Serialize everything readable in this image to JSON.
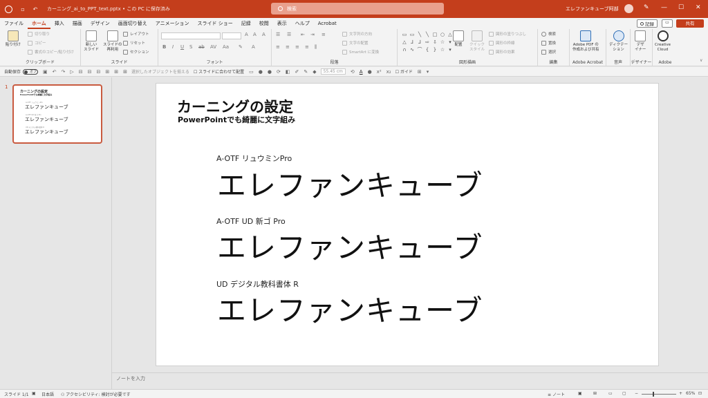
{
  "titlebar": {
    "doc_title": "カーニング_ai_to_PPT_text.pptx • この PC に保存済み",
    "search_placeholder": "検索",
    "user": "エレファンキューブ阿部",
    "accent": "#c43e1c"
  },
  "menu": {
    "tabs": [
      "ファイル",
      "ホーム",
      "挿入",
      "描画",
      "デザイン",
      "画面切り替え",
      "アニメーション",
      "スライド ショー",
      "記録",
      "校閲",
      "表示",
      "ヘルプ",
      "Acrobat"
    ],
    "active_tab": "ホーム",
    "record_label": "記録",
    "share_label": "共有"
  },
  "ribbon": {
    "clipboard": {
      "label": "クリップボード",
      "paste": "貼り付け",
      "cut": "切り取り",
      "copy": "コピー",
      "format_painter": "書式のコピー/貼り付け"
    },
    "slides": {
      "label": "スライド",
      "new_slide": "新しい\nスライド",
      "reuse": "スライドの\n再利用",
      "layout": "レイアウト",
      "reset": "リセット",
      "section": "セクション"
    },
    "font": {
      "label": "フォント"
    },
    "paragraph": {
      "label": "段落",
      "text_direction": "文字列の方向",
      "align_text": "文字の配置",
      "smartart": "SmartArt に変換"
    },
    "drawing": {
      "label": "図形描画",
      "arrange": "配置",
      "quick_styles": "クイック\nスタイル",
      "fill": "図形の塗りつぶし",
      "outline": "図形の枠線",
      "effects": "図形の効果"
    },
    "editing": {
      "label": "編集",
      "find": "検索",
      "replace": "置換",
      "select": "選択"
    },
    "acrobat": {
      "label": "Adobe Acrobat",
      "create_pdf": "Adobe PDF の\n作成および共有"
    },
    "voice": {
      "label": "音声",
      "dictate": "ディクテー\nション"
    },
    "designer": {
      "label": "デザイナー",
      "designer": "デザ\nイナー"
    },
    "adobe": {
      "label": "Adobe",
      "cc": "Creative\nCloud"
    }
  },
  "qat": {
    "autosave": "自動保存",
    "toggle": "オフ",
    "select_same": "選択したオブジェクトを揃える",
    "fit_slide": "スライドに合わせて配置",
    "size_value": "55.45 cm",
    "guide": "ガイド"
  },
  "thumbnail": {
    "number": "1",
    "title": "カーニングの設定",
    "subtitle": "PowerPointでも綺麗に文字組み",
    "sample": "エレファンキューブ"
  },
  "slide": {
    "title": "カーニングの設定",
    "subtitle": "PowerPointでも綺麗に文字組み",
    "samples": [
      {
        "font_label": "A-OTF リュウミンPro",
        "text": "エレファンキューブ"
      },
      {
        "font_label": "A-OTF UD 新ゴ Pro",
        "text": "エレファンキューブ"
      },
      {
        "font_label": "UD デジタル教科書体 R",
        "text": "エレファンキューブ"
      }
    ]
  },
  "notes_placeholder": "ノートを入力",
  "status": {
    "slide_pos": "スライド 1/1",
    "language": "日本語",
    "accessibility": "アクセシビリティ: 検討が必要です",
    "notes_btn": "ノート",
    "zoom": "65%"
  }
}
